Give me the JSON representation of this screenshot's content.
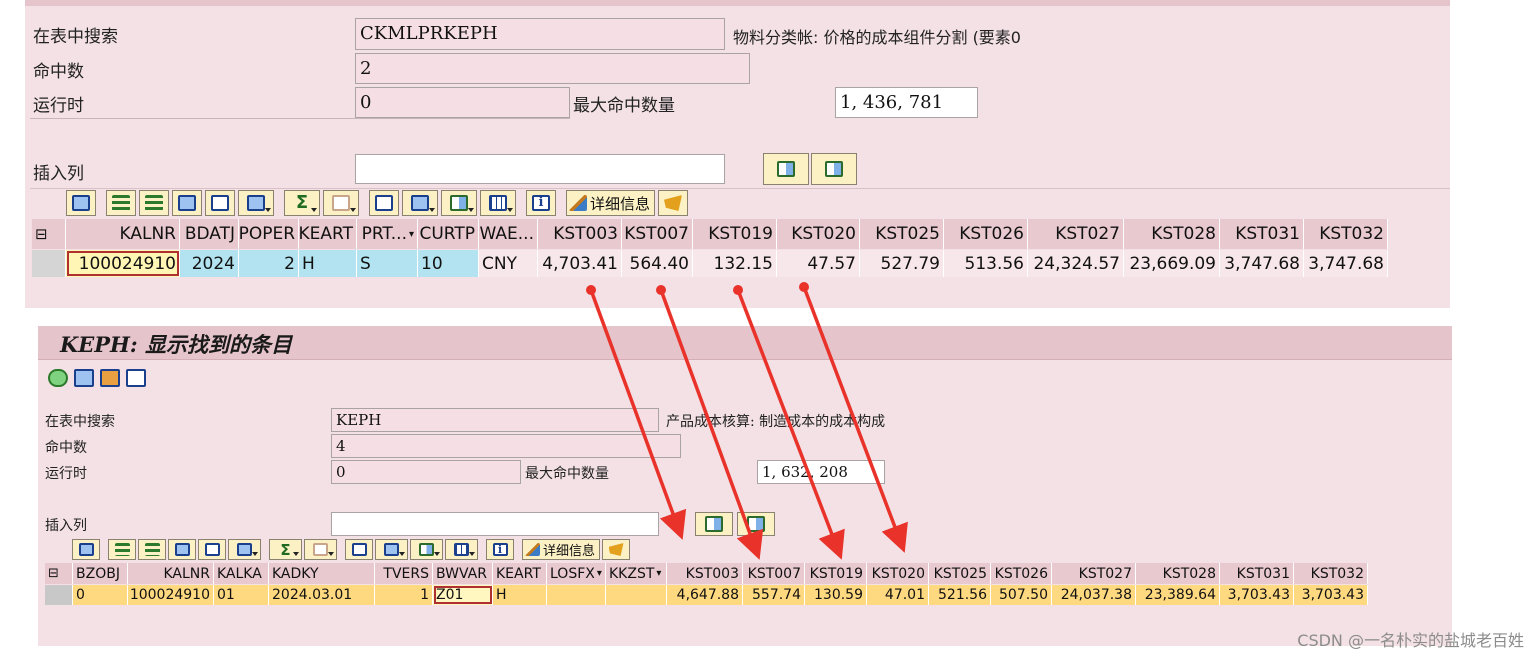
{
  "top": {
    "search_label": "在表中搜索",
    "search_value": "CKMLPRKEPH",
    "table_desc": "物料分类帐: 价格的成本组件分割 (要素0",
    "hits_label": "命中数",
    "hits_value": "2",
    "runtime_label": "运行时",
    "runtime_value": "0",
    "max_hits_label": "最大命中数量",
    "max_hits_value": "1, 436, 781",
    "insert_col_label": "插入列",
    "insert_col_value": "",
    "detail_button": "详细信息",
    "columns": [
      "KALNR",
      "BDATJ",
      "POPER",
      "KEART",
      "PRT...",
      "CURTP",
      "WAE...",
      "KST003",
      "KST007",
      "KST019",
      "KST020",
      "KST025",
      "KST026",
      "KST027",
      "KST028",
      "KST031",
      "KST032"
    ],
    "row": [
      "100024910",
      "2024",
      "2",
      "H",
      "S",
      "10",
      "CNY",
      "4,703.41",
      "564.40",
      "132.15",
      "47.57",
      "527.79",
      "513.56",
      "24,324.57",
      "23,669.09",
      "3,747.68",
      "3,747.68"
    ]
  },
  "bottom": {
    "window_title": "KEPH: 显示找到的条目",
    "search_label": "在表中搜索",
    "search_value": "KEPH",
    "table_desc": "产品成本核算: 制造成本的成本构成",
    "hits_label": "命中数",
    "hits_value": "4",
    "runtime_label": "运行时",
    "runtime_value": "0",
    "max_hits_label": "最大命中数量",
    "max_hits_value": "1, 632, 208",
    "insert_col_label": "插入列",
    "insert_col_value": "",
    "detail_button": "详细信息",
    "columns": [
      "BZOBJ",
      "KALNR",
      "KALKA",
      "KADKY",
      "TVERS",
      "BWVAR",
      "KEART",
      "LOSFX",
      "KKZST",
      "KST003",
      "KST007",
      "KST019",
      "KST020",
      "KST025",
      "KST026",
      "KST027",
      "KST028",
      "KST031",
      "KST032"
    ],
    "row": [
      "0",
      "100024910",
      "01",
      "2024.03.01",
      "1",
      "Z01",
      "H",
      "",
      "",
      "4,647.88",
      "557.74",
      "130.59",
      "47.01",
      "521.56",
      "507.50",
      "24,037.38",
      "23,389.64",
      "3,703.43",
      "3,703.43"
    ]
  },
  "watermark": "CSDN @一名朴实的盐城老百姓",
  "colors": {
    "panel": "#f3e1e5",
    "header": "#e8c9cf",
    "key_cell": "#fff5b4",
    "cyan_cell": "#b3e3f0",
    "row_highlight": "#ffd980",
    "arrow": "#e8322a"
  }
}
